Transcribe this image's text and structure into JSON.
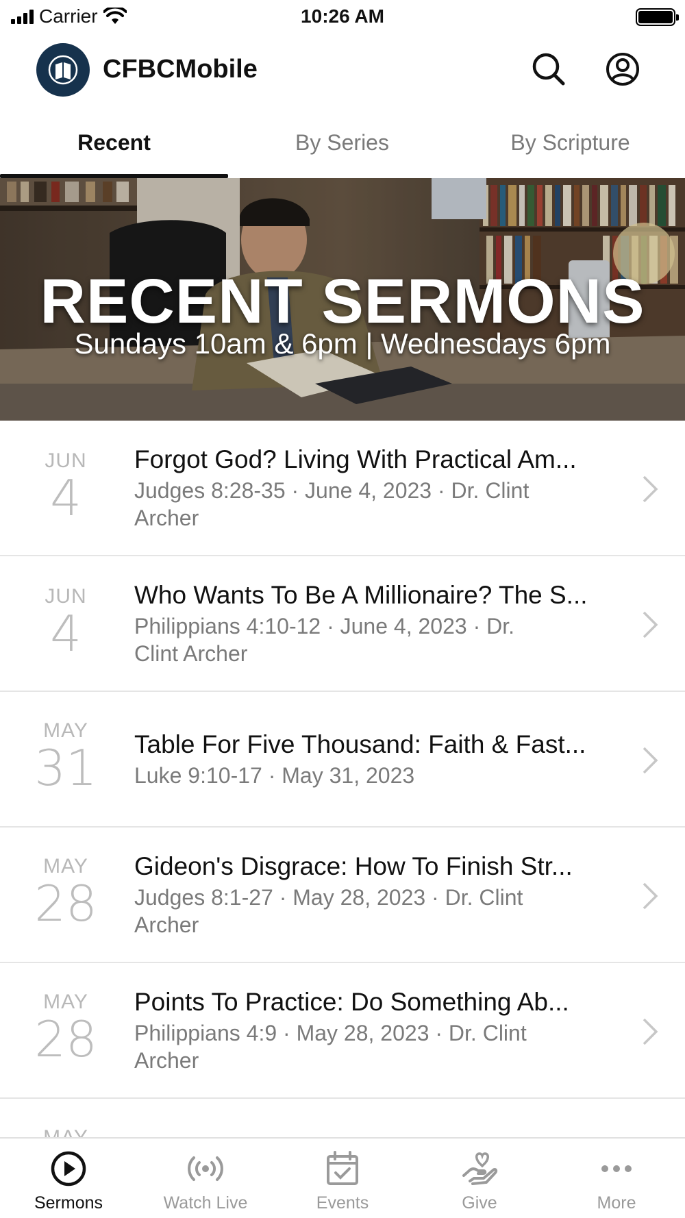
{
  "status_bar": {
    "carrier": "Carrier",
    "time": "10:26 AM"
  },
  "header": {
    "app_title": "CFBCMobile"
  },
  "tabs": [
    {
      "label": "Recent",
      "active": true
    },
    {
      "label": "By Series",
      "active": false
    },
    {
      "label": "By Scripture",
      "active": false
    }
  ],
  "banner": {
    "title": "RECENT SERMONS",
    "subtitle": "Sundays 10am & 6pm  |  Wednesdays 6pm"
  },
  "sermons": [
    {
      "month": "JUN",
      "day": "4",
      "title": "Forgot God? Living With Practical Am...",
      "meta": "Judges 8:28-35 · June 4, 2023 · Dr. Clint Archer"
    },
    {
      "month": "JUN",
      "day": "4",
      "title": "Who Wants To Be A Millionaire? The S...",
      "meta": "Philippians 4:10-12 · June 4, 2023 · Dr. Clint Archer"
    },
    {
      "month": "MAY",
      "day": "31",
      "title": "Table For Five Thousand: Faith & Fast...",
      "meta": "Luke 9:10-17 · May 31, 2023"
    },
    {
      "month": "MAY",
      "day": "28",
      "title": "Gideon's Disgrace: How To Finish Str...",
      "meta": "Judges 8:1-27 · May 28, 2023 · Dr. Clint Archer"
    },
    {
      "month": "MAY",
      "day": "28",
      "title": "Points To Practice: Do Something Ab...",
      "meta": "Philippians 4:9 · May 28, 2023 · Dr. Clint Archer"
    },
    {
      "month": "MAY",
      "day": "",
      "title": "",
      "meta": ""
    }
  ],
  "bottom_nav": [
    {
      "label": "Sermons",
      "icon": "play-circle-icon",
      "active": true
    },
    {
      "label": "Watch Live",
      "icon": "broadcast-icon",
      "active": false
    },
    {
      "label": "Events",
      "icon": "calendar-check-icon",
      "active": false
    },
    {
      "label": "Give",
      "icon": "give-hand-heart-icon",
      "active": false
    },
    {
      "label": "More",
      "icon": "more-dots-icon",
      "active": false
    }
  ],
  "colors": {
    "logo_bg": "#16324d",
    "active_text": "#111111",
    "inactive_text": "#9a9a9a",
    "divider": "#e5e5e5"
  }
}
